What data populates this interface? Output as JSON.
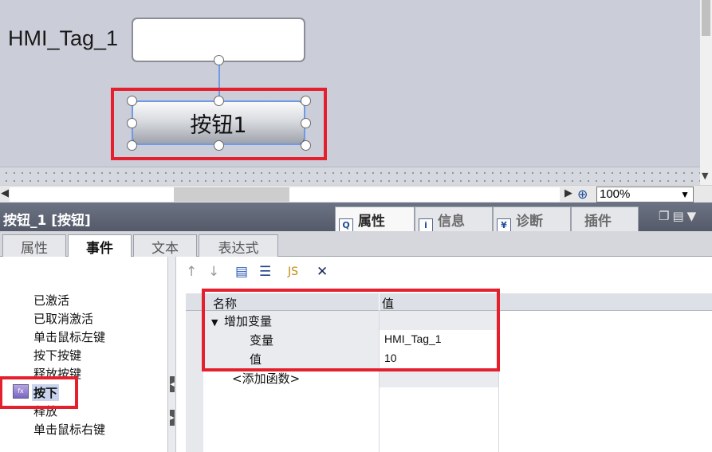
{
  "canvas": {
    "tag_label": "HMI_Tag_1",
    "button_label": "按钮1"
  },
  "zoom": {
    "value": "100%"
  },
  "inspector": {
    "title": "按钮_1 [按钮]",
    "tabs": [
      {
        "label": "属性",
        "icon": "properties-icon",
        "active": true
      },
      {
        "label": "信息",
        "icon": "info-icon",
        "active": false
      },
      {
        "label": "诊断",
        "icon": "diagnostics-icon",
        "active": false
      },
      {
        "label": "插件",
        "icon": "",
        "active": false
      }
    ]
  },
  "subtabs": [
    "属性",
    "事件",
    "文本",
    "表达式"
  ],
  "events": [
    "已激活",
    "已取消激活",
    "单击鼠标左键",
    "按下按键",
    "释放按键",
    "按下",
    "释放",
    "单击鼠标右键"
  ],
  "selected_event": "按下",
  "table": {
    "col_name": "名称",
    "col_value": "值",
    "function_name": "增加变量",
    "params": [
      {
        "name": "变量",
        "value": "HMI_Tag_1"
      },
      {
        "name": "值",
        "value": "10"
      }
    ],
    "add_function": "<添加函数>"
  },
  "colors": {
    "highlight_red": "#e5202e",
    "selection_blue": "#6f9ae8",
    "title_bar": "#5f6676"
  }
}
